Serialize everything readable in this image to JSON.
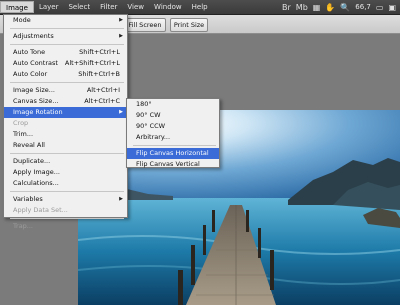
{
  "menubar": {
    "items": [
      "Image",
      "Layer",
      "Select",
      "Filter",
      "View",
      "Window",
      "Help"
    ],
    "zoom": "66,7"
  },
  "optionsbar": {
    "fill_screen": "Fill Screen",
    "print_size": "Print Size"
  },
  "image_menu": {
    "mode": "Mode",
    "adjustments": "Adjustments",
    "auto_tone": "Auto Tone",
    "auto_tone_sc": "Shift+Ctrl+L",
    "auto_contrast": "Auto Contrast",
    "auto_contrast_sc": "Alt+Shift+Ctrl+L",
    "auto_color": "Auto Color",
    "auto_color_sc": "Shift+Ctrl+B",
    "image_size": "Image Size...",
    "image_size_sc": "Alt+Ctrl+I",
    "canvas_size": "Canvas Size...",
    "canvas_size_sc": "Alt+Ctrl+C",
    "image_rotation": "Image Rotation",
    "crop": "Crop",
    "trim": "Trim...",
    "reveal_all": "Reveal All",
    "duplicate": "Duplicate...",
    "apply_image": "Apply Image...",
    "calculations": "Calculations...",
    "variables": "Variables",
    "apply_data_set": "Apply Data Set...",
    "trap": "Trap..."
  },
  "rotation_menu": {
    "r180": "180°",
    "r90cw": "90° CW",
    "r90ccw": "90° CCW",
    "arbitrary": "Arbitrary...",
    "flip_h": "Flip Canvas Horizontal",
    "flip_v": "Flip Canvas Vertical"
  },
  "colors": {
    "menubar_bg": "#404040",
    "highlight": "#3a6bd6",
    "menu_bg": "#f0f0f0"
  }
}
